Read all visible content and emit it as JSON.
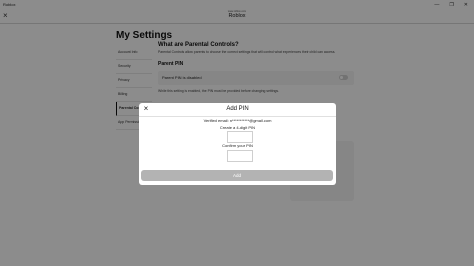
{
  "window": {
    "app_name": "Roblox",
    "controls": [
      "—",
      "❐",
      "✕"
    ]
  },
  "appbar": {
    "subtitle": "www.roblox.com",
    "title": "Roblox"
  },
  "page": {
    "heading": "My Settings",
    "nav": [
      {
        "label": "Account Info"
      },
      {
        "label": "Security"
      },
      {
        "label": "Privacy"
      },
      {
        "label": "Billing"
      },
      {
        "label": "Parental Controls"
      },
      {
        "label": "App Permissions"
      }
    ],
    "content": {
      "question": "What are Parental Controls?",
      "description": "Parental Controls allow parents to choose the correct settings that will control what experiences their child can access.",
      "section": "Parent PIN",
      "pin_status": "Parent PIN is disabled",
      "pin_note": "While this setting is enabled, the PIN must be provided before changing settings."
    }
  },
  "modal": {
    "title": "Add PIN",
    "verified_email": "Verified email: n***********@gmail.com",
    "create_label": "Create a 4-digit PIN",
    "confirm_label": "Confirm your PIN",
    "add_button": "Add"
  }
}
